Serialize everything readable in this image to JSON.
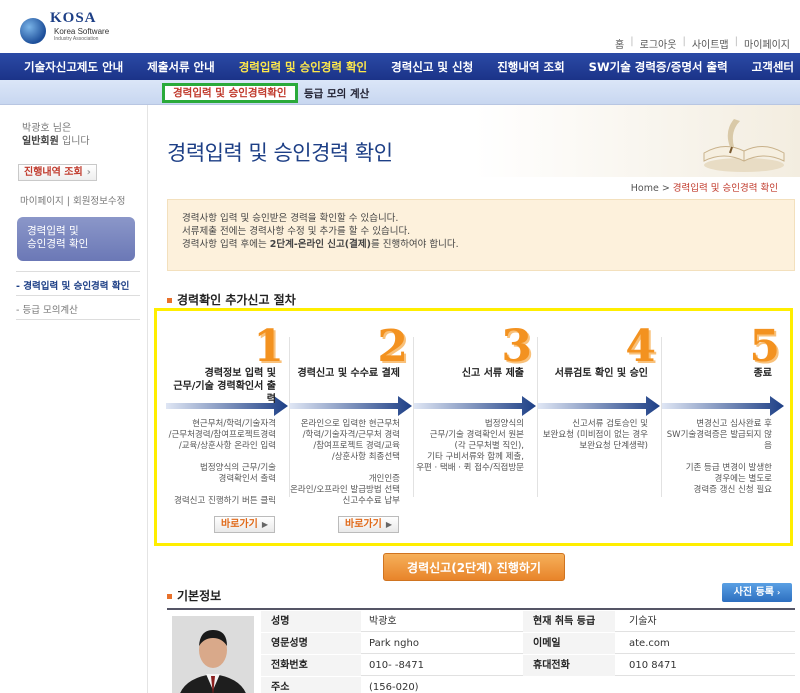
{
  "brand": {
    "name": "KOSA",
    "sub1": "Korea Software",
    "sub2": "Industry Association"
  },
  "util": [
    "홈",
    "로그아웃",
    "사이트맵",
    "마이페이지"
  ],
  "gnb": [
    "기술자신고제도 안내",
    "제출서류 안내",
    "경력입력 및 승인경력 확인",
    "경력신고 및 신청",
    "진행내역 조회",
    "SW기술 경력증/증명서 출력",
    "고객센터"
  ],
  "gnb_active": 2,
  "snb": {
    "active": "경력입력 및 승인경력확인",
    "sub": "등급 모의 계산"
  },
  "lnb": {
    "user_name": "박광호 님은",
    "user_grade": "일반회원",
    "user_suffix": " 입니다",
    "history_btn": "진행내역 조회",
    "mypage": "마이페이지",
    "member_edit": "회원정보수정",
    "menu_title_1": "경력입력 및",
    "menu_title_2": "승인경력 확인",
    "sub_items": [
      "경력입력 및 승인경력 확인",
      "등급 모의계산"
    ]
  },
  "page": {
    "title": "경력입력 및 승인경력 확인"
  },
  "breadcrumb": {
    "home": "Home",
    "current": "경력입력 및 승인경력 확인"
  },
  "notice": [
    "경력사항 입력 및 승인받은 경력을 확인할 수 있습니다.",
    "서류제출 전에는 경력사항 수정 및 추가를 할 수 있습니다."
  ],
  "notice3": {
    "pre": "경력사항 입력 후에는 ",
    "bold": "2단계-온라인 신고(결제)",
    "post": "를 진행하여야 합니다."
  },
  "process": {
    "heading": "경력확인 추가신고 절차",
    "steps": [
      {
        "num": "1",
        "title1": "경력정보 입력 및",
        "title2": "근무/기술 경력확인서 출력",
        "desc": [
          "현근무처/학력/기술자격",
          "/근무처경력/참여프로젝트경력",
          "/교육/상훈사항 온라인 입력",
          "",
          "법정양식의 근무/기술",
          "경력확인서 출력",
          "",
          "경력신고 진행하기 버튼 클릭"
        ],
        "go": "바로가기"
      },
      {
        "num": "2",
        "title1": "",
        "title2": "경력신고 및 수수료 결제",
        "desc": [
          "온라인으로 입력한 현근무처",
          "/학력/기술자격/근무처 경력",
          "/참여프로젝트 경력/교육",
          "/상훈사항 최종선택",
          "",
          "개인인증",
          "온라인/오프라인 발급방법 선택",
          "신고수수료 납부"
        ],
        "go": "바로가기"
      },
      {
        "num": "3",
        "title1": "",
        "title2": "신고 서류 제출",
        "desc": [
          "법정양식의",
          "근무/기술 경력확인서 원본",
          "(각 근무처별 직인),",
          "기타 구비서류와 함께 제출,",
          "우편 · 택배 · 퀵 접수/직접방문"
        ],
        "go": ""
      },
      {
        "num": "4",
        "title1": "",
        "title2": "서류검토 확인 및 승인",
        "desc": [
          "신고서류 검토승인 및",
          "보완요청 (미비점이 없는 경우",
          "보완요청 단계생략)"
        ],
        "go": ""
      },
      {
        "num": "5",
        "title1": "",
        "title2": "종료",
        "desc": [
          "변경신고 심사완료 후",
          "SW기술경력증은 발급되지 않음",
          "",
          "기존 등급 변경이 발생한",
          "경우에는 별도로",
          "경력증 갱신 신청 필요"
        ],
        "go": ""
      }
    ]
  },
  "apply_btn": "경력신고(2단계) 진행하기",
  "basic": {
    "heading": "기본정보",
    "photo_btn": "사진 등록",
    "rows": [
      {
        "l1": "성명",
        "v1": "박광호",
        "l2": "현재 취득 등급",
        "v2": "기술자"
      },
      {
        "l1": "영문성명",
        "v1": "Park        ngho",
        "l2": "이메일",
        "v2": "                ate.com"
      },
      {
        "l1": "전화번호",
        "v1": "010-        -8471",
        "l2": "휴대전화",
        "v2": "010            8471"
      },
      {
        "l1": "주소",
        "v1": "(156-020)",
        "l2": "",
        "v2": ""
      }
    ]
  },
  "colors": {
    "navy": "#1d3f86",
    "orange": "#f39220",
    "highlight": "#ffee00",
    "green": "#2aaa3a"
  }
}
